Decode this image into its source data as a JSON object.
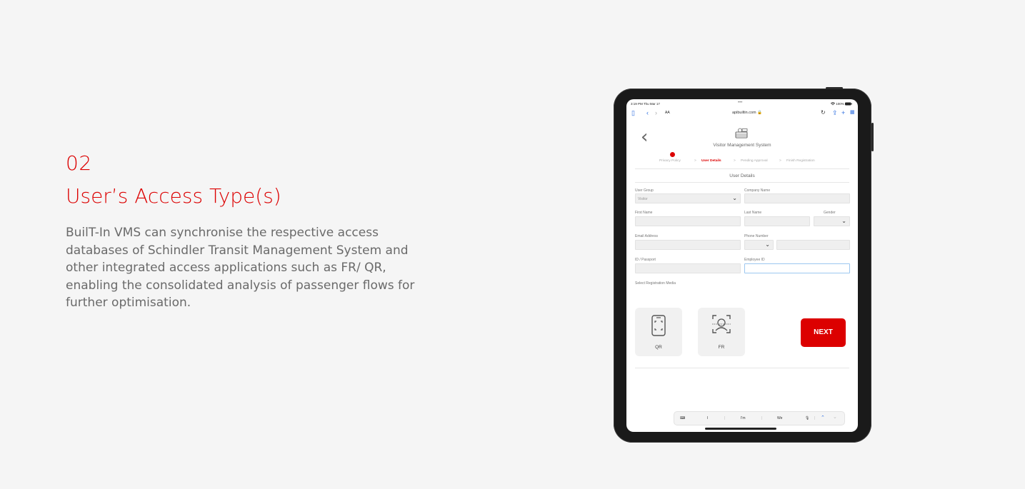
{
  "section": {
    "number": "02",
    "title": "User’s Access Type(s)",
    "description": "BuilT-In VMS can synchronise the respective access databases of Schindler Transit Management System and other integrated access applications such as FR/ QR, enabling the consolidated analysis of passenger flows for further optimisation."
  },
  "device": {
    "status": {
      "time": "3:19 PM  Thu Mar 17",
      "dots": "•••",
      "battery": "100%"
    },
    "browser": {
      "aa": "AA",
      "url": "apibuiltin.com"
    },
    "app_title": "Visitor Management System",
    "steps": [
      "Privacy Policy",
      "User Details",
      "Pending Approval",
      "Finish Registration"
    ],
    "step_separator": ">",
    "form_title": "User Details",
    "labels": {
      "user_group": "User Group",
      "company_name": "Company Name",
      "first_name": "First Name",
      "last_name": "Last Name",
      "gender": "Gender",
      "email": "Email Address",
      "phone": "Phone Number",
      "id_passport": "ID / Passport",
      "employee_id": "Employee ID",
      "select_media": "Select Registration Media"
    },
    "values": {
      "user_group": "Visitor"
    },
    "media": {
      "qr": "QR",
      "fr": "FR"
    },
    "next_label": "NEXT",
    "keyboard": {
      "s1": "I",
      "s2": "I'm",
      "s3": "We"
    },
    "accent_color": "#dc0000"
  }
}
